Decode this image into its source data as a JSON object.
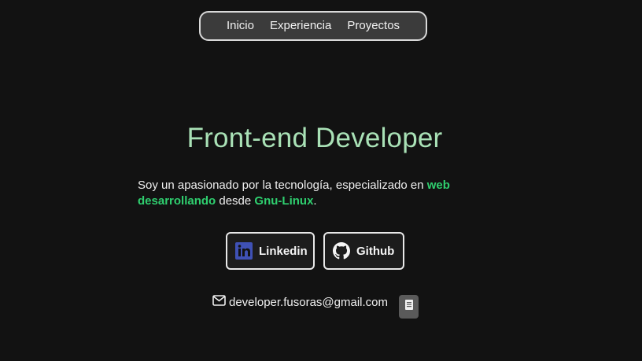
{
  "nav": {
    "items": [
      {
        "label": "Inicio"
      },
      {
        "label": "Experiencia"
      },
      {
        "label": "Proyectos"
      }
    ]
  },
  "hero": {
    "title": "Front-end Developer",
    "bio": {
      "part1": "Soy un apasionado por la tecnología, especializado en ",
      "highlight1": "web desarrollando",
      "part2": " desde ",
      "highlight2": "Gnu-Linux",
      "part3": "."
    }
  },
  "links": {
    "linkedin_label": "Linkedin",
    "github_label": "Github"
  },
  "contact": {
    "email": "developer.fusoras@gmail.com"
  },
  "icons": {
    "nav": [],
    "linkedin": "linkedin-icon",
    "github": "github-icon",
    "mail": "mail-icon",
    "copy": "copy-icon"
  },
  "colors": {
    "background": "#121212",
    "title": "#a9e1b6",
    "highlight": "#2fcf6f",
    "linkedin": "#3f51b5"
  }
}
